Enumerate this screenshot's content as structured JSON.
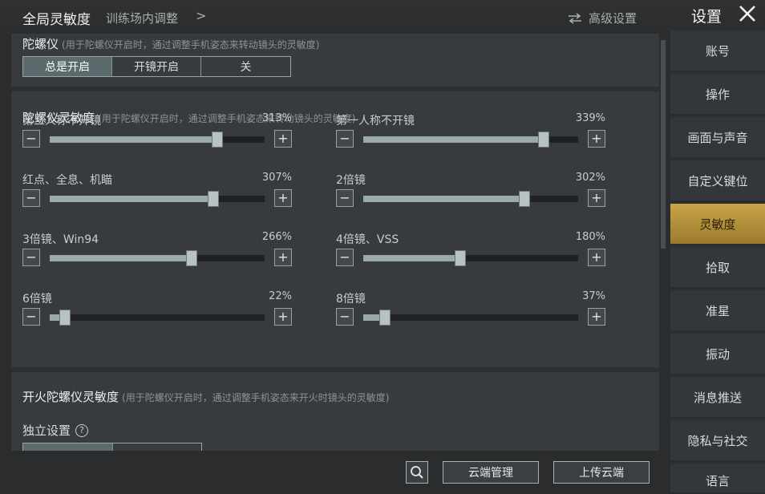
{
  "header": {
    "title": "全局灵敏度",
    "subtitle": "训练场内调整",
    "chevron": ">",
    "advanced_label": "高级设置",
    "settings_label": "设置"
  },
  "gyro": {
    "title": "陀螺仪",
    "note": "(用于陀螺仪开启时，通过调整手机姿态来转动镜头的灵敏度)",
    "options": [
      "总是开启",
      "开镜开启",
      "关"
    ],
    "selected": "总是开启"
  },
  "gyro_sens": {
    "title": "陀螺仪灵敏度",
    "note": "(用于陀螺仪开启时，通过调整手机姿态来转动镜头的灵敏度)",
    "minus_glyph": "−",
    "plus_glyph": "+",
    "sliders": [
      {
        "label": "第三人称不开镜",
        "value": "313%",
        "fill": 0.78
      },
      {
        "label": "第一人称不开镜",
        "value": "339%",
        "fill": 0.84
      },
      {
        "label": "红点、全息、机瞄",
        "value": "307%",
        "fill": 0.76
      },
      {
        "label": "2倍镜",
        "value": "302%",
        "fill": 0.75
      },
      {
        "label": "3倍镜、Win94",
        "value": "266%",
        "fill": 0.66
      },
      {
        "label": "4倍镜、VSS",
        "value": "180%",
        "fill": 0.45
      },
      {
        "label": "6倍镜",
        "value": "22%",
        "fill": 0.07
      },
      {
        "label": "8倍镜",
        "value": "37%",
        "fill": 0.1
      }
    ]
  },
  "fire_gyro": {
    "title": "开火陀螺仪灵敏度",
    "note": "(用于陀螺仪开启时，通过调整手机姿态来开火时镜头的灵敏度)",
    "independent_label": "独立设置",
    "help_glyph": "?"
  },
  "sidebar": {
    "items": [
      "账号",
      "操作",
      "画面与声音",
      "自定义键位",
      "灵敏度",
      "拾取",
      "准星",
      "振动",
      "消息推送",
      "隐私与社交",
      "语言"
    ],
    "active": "灵敏度"
  },
  "bottom": {
    "cloud_manage": "云端管理",
    "upload_cloud": "上传云端"
  },
  "colors": {
    "accent_gold": "#c9a54a",
    "panel": "#383b3d",
    "slider_fill": "#9aaaaa"
  }
}
